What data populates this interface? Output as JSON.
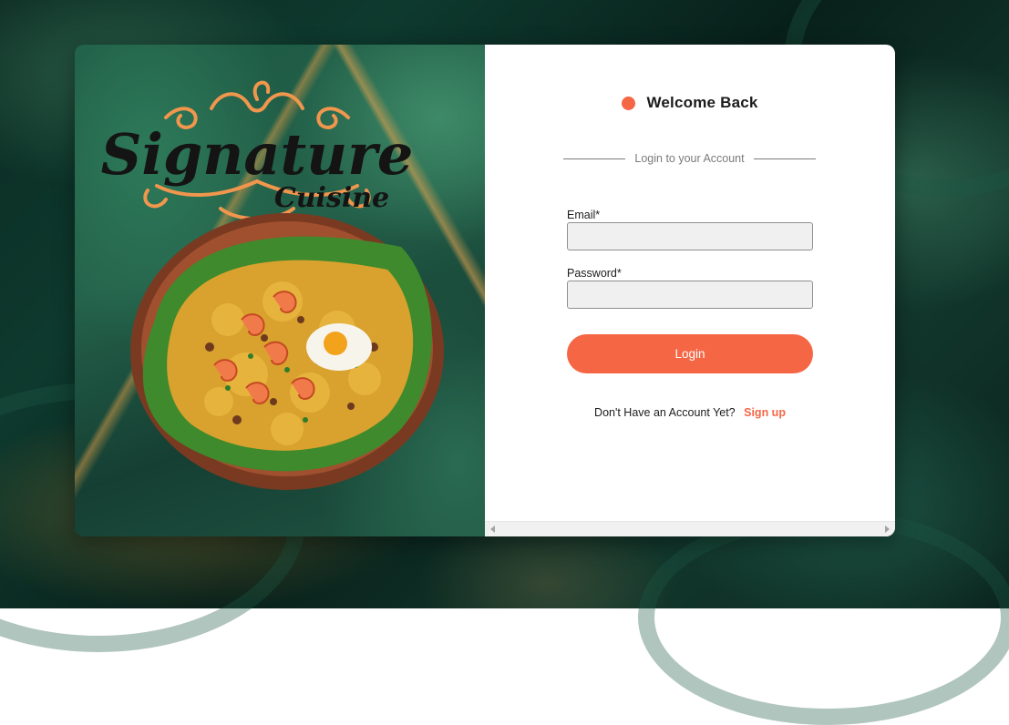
{
  "brand": {
    "logo_text_main": "Signature",
    "logo_text_sub": "Cuisine"
  },
  "login": {
    "title": "Welcome Back",
    "subtitle": "Login to your Account",
    "email_label": "Email*",
    "email_value": "",
    "password_label": "Password*",
    "password_value": "",
    "login_button": "Login",
    "signup_prompt": "Don't Have an Account Yet?",
    "signup_link": "Sign up"
  },
  "colors": {
    "accent": "#f56645",
    "background_dark_green": "#0e3a2e",
    "card_white": "#ffffff",
    "input_fill": "#f0f0f0"
  },
  "icons": {
    "welcome_dot": "orange-dot-icon",
    "scroll_left": "scroll-left-arrow-icon",
    "scroll_right": "scroll-right-arrow-icon"
  }
}
